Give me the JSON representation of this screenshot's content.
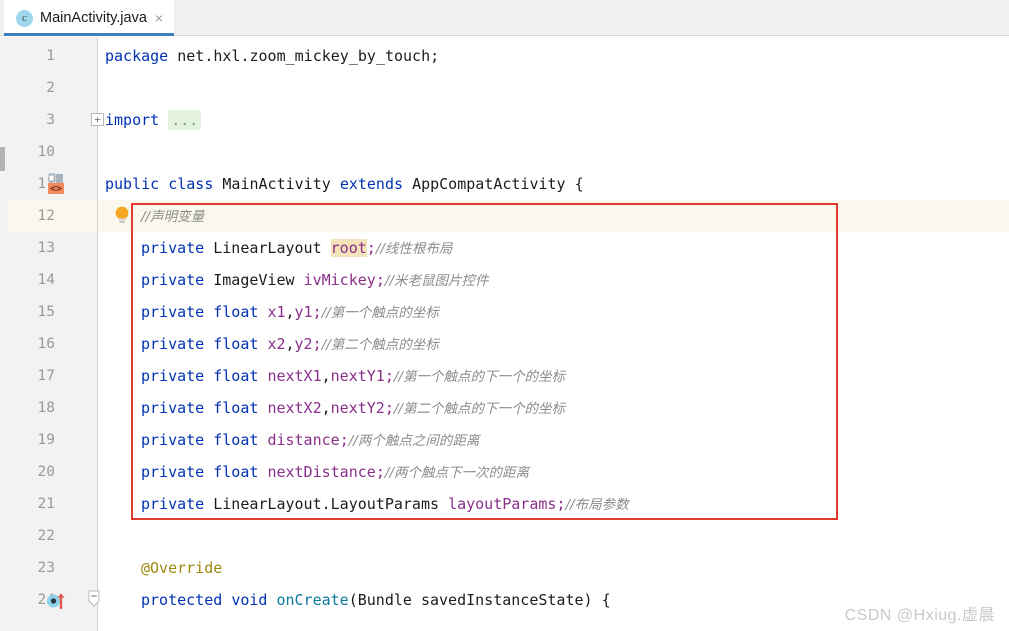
{
  "window": {
    "title": "MainActivity.java"
  },
  "tabbar": {
    "active_tab": {
      "label": "MainActivity.java",
      "file_icon": "java-class-icon",
      "icon_letter": "c",
      "close_label": "×"
    }
  },
  "editor": {
    "caret_line": 12,
    "gutter": {
      "line_numbers": [
        "1",
        "2",
        "3",
        "10",
        "11",
        "12",
        "13",
        "14",
        "15",
        "16",
        "17",
        "18",
        "19",
        "20",
        "21",
        "22",
        "23",
        "24"
      ],
      "icons": {
        "fold_expand_label": "+",
        "fold_collapse_label": "–"
      }
    },
    "lines": [
      {
        "num": "1",
        "tokens": [
          {
            "t": "package ",
            "c": "kw"
          },
          {
            "t": "net.hxl.zoom_mickey_by_touch;",
            "c": "plain"
          }
        ]
      },
      {
        "num": "2",
        "tokens": []
      },
      {
        "num": "3",
        "tokens": [
          {
            "t": "import ",
            "c": "kw"
          },
          {
            "t": "...",
            "c": "dots"
          }
        ]
      },
      {
        "num": "10",
        "tokens": []
      },
      {
        "num": "11",
        "tokens": [
          {
            "t": "public ",
            "c": "kw"
          },
          {
            "t": "class ",
            "c": "kw"
          },
          {
            "t": "MainActivity ",
            "c": "plain"
          },
          {
            "t": "extends ",
            "c": "kw"
          },
          {
            "t": "AppCompatActivity {",
            "c": "plain"
          }
        ]
      },
      {
        "num": "12",
        "indent": 2,
        "tokens": [
          {
            "t": "//声明变量",
            "c": "comment cn"
          }
        ]
      },
      {
        "num": "13",
        "indent": 2,
        "tokens": [
          {
            "t": "private ",
            "c": "kw"
          },
          {
            "t": "LinearLayout ",
            "c": "plain"
          },
          {
            "t": "root",
            "c": "hl-token"
          },
          {
            "t": ";",
            "c": "field"
          },
          {
            "t": "//线性根布局",
            "c": "comment cn"
          }
        ]
      },
      {
        "num": "14",
        "indent": 2,
        "tokens": [
          {
            "t": "private ",
            "c": "kw"
          },
          {
            "t": "ImageView ",
            "c": "plain"
          },
          {
            "t": "ivMickey",
            "c": "field"
          },
          {
            "t": ";",
            "c": "field"
          },
          {
            "t": "//米老鼠图片控件",
            "c": "comment cn"
          }
        ]
      },
      {
        "num": "15",
        "indent": 2,
        "tokens": [
          {
            "t": "private ",
            "c": "kw"
          },
          {
            "t": "float ",
            "c": "kw"
          },
          {
            "t": "x1",
            "c": "field"
          },
          {
            "t": ",",
            "c": "plain"
          },
          {
            "t": "y1",
            "c": "field"
          },
          {
            "t": ";",
            "c": "field"
          },
          {
            "t": "//第一个触点的坐标",
            "c": "comment cn"
          }
        ]
      },
      {
        "num": "16",
        "indent": 2,
        "tokens": [
          {
            "t": "private ",
            "c": "kw"
          },
          {
            "t": "float ",
            "c": "kw"
          },
          {
            "t": "x2",
            "c": "field"
          },
          {
            "t": ",",
            "c": "plain"
          },
          {
            "t": "y2",
            "c": "field"
          },
          {
            "t": ";",
            "c": "field"
          },
          {
            "t": "//第二个触点的坐标",
            "c": "comment cn"
          }
        ]
      },
      {
        "num": "17",
        "indent": 2,
        "tokens": [
          {
            "t": "private ",
            "c": "kw"
          },
          {
            "t": "float ",
            "c": "kw"
          },
          {
            "t": "nextX1",
            "c": "field"
          },
          {
            "t": ",",
            "c": "plain"
          },
          {
            "t": "nextY1",
            "c": "field"
          },
          {
            "t": ";",
            "c": "field"
          },
          {
            "t": "//第一个触点的下一个的坐标",
            "c": "comment cn"
          }
        ]
      },
      {
        "num": "18",
        "indent": 2,
        "tokens": [
          {
            "t": "private ",
            "c": "kw"
          },
          {
            "t": "float ",
            "c": "kw"
          },
          {
            "t": "nextX2",
            "c": "field"
          },
          {
            "t": ",",
            "c": "plain"
          },
          {
            "t": "nextY2",
            "c": "field"
          },
          {
            "t": ";",
            "c": "field"
          },
          {
            "t": "//第二个触点的下一个的坐标",
            "c": "comment cn"
          }
        ]
      },
      {
        "num": "19",
        "indent": 2,
        "tokens": [
          {
            "t": "private ",
            "c": "kw"
          },
          {
            "t": "float ",
            "c": "kw"
          },
          {
            "t": "distance",
            "c": "field"
          },
          {
            "t": ";",
            "c": "field"
          },
          {
            "t": "//两个触点之间的距离",
            "c": "comment cn"
          }
        ]
      },
      {
        "num": "20",
        "indent": 2,
        "tokens": [
          {
            "t": "private ",
            "c": "kw"
          },
          {
            "t": "float ",
            "c": "kw"
          },
          {
            "t": "nextDistance",
            "c": "field"
          },
          {
            "t": ";",
            "c": "field"
          },
          {
            "t": "//两个触点下一次的距离",
            "c": "comment cn"
          }
        ]
      },
      {
        "num": "21",
        "indent": 2,
        "tokens": [
          {
            "t": "private ",
            "c": "kw"
          },
          {
            "t": "LinearLayout.LayoutParams ",
            "c": "plain"
          },
          {
            "t": "layoutParams",
            "c": "field"
          },
          {
            "t": ";",
            "c": "field"
          },
          {
            "t": "//布局参数",
            "c": "comment cn"
          }
        ]
      },
      {
        "num": "22",
        "tokens": []
      },
      {
        "num": "23",
        "indent": 2,
        "tokens": [
          {
            "t": "@Override",
            "c": "anno"
          }
        ]
      },
      {
        "num": "24",
        "indent": 2,
        "tokens": [
          {
            "t": "protected ",
            "c": "kw"
          },
          {
            "t": "void ",
            "c": "kw"
          },
          {
            "t": "onCreate",
            "c": "method"
          },
          {
            "t": "(Bundle savedInstanceState) {",
            "c": "plain"
          }
        ]
      }
    ]
  },
  "annotation": {
    "red_box_label": "declared-variables-highlight",
    "red_box_color": "#e03a2f"
  },
  "watermark": {
    "text": "CSDN @Hxiug.虚晨"
  }
}
